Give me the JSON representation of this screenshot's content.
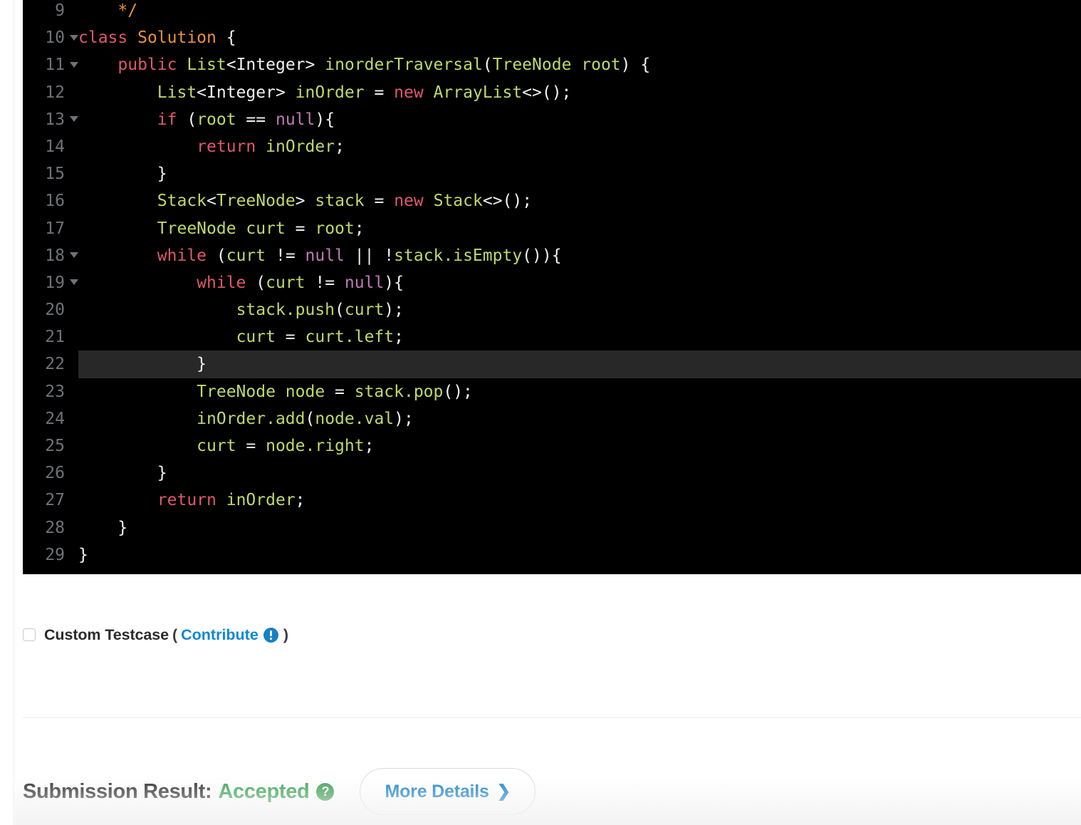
{
  "editor": {
    "language": "java",
    "theme_background": "#000000",
    "active_line": 22,
    "colors": {
      "keyword": "#e0586a",
      "identifier": "#bfd96a",
      "null_literal": "#c07ab5",
      "class_name": "#e9913f",
      "comment": "#e9913f",
      "punctuation": "#f2f2f2",
      "gutter": "#6f7276",
      "active_line_bg": "#282828"
    },
    "lines": [
      {
        "n": "9",
        "fold": false,
        "tokens": [
          {
            "t": "    ",
            "c": "plain"
          },
          {
            "t": "*/",
            "c": "cmt"
          }
        ]
      },
      {
        "n": "10",
        "fold": true,
        "tokens": [
          {
            "t": "class ",
            "c": "kw"
          },
          {
            "t": "Solution",
            "c": "class"
          },
          {
            "t": " {",
            "c": "plain"
          }
        ]
      },
      {
        "n": "11",
        "fold": true,
        "tokens": [
          {
            "t": "    ",
            "c": "plain"
          },
          {
            "t": "public",
            "c": "kw"
          },
          {
            "t": " ",
            "c": "plain"
          },
          {
            "t": "List",
            "c": "type"
          },
          {
            "t": "<Integer>",
            "c": "plain"
          },
          {
            "t": " ",
            "c": "plain"
          },
          {
            "t": "inorderTraversal",
            "c": "id"
          },
          {
            "t": "(",
            "c": "plain"
          },
          {
            "t": "TreeNode root",
            "c": "id"
          },
          {
            "t": ") {",
            "c": "plain"
          }
        ]
      },
      {
        "n": "12",
        "fold": false,
        "tokens": [
          {
            "t": "        ",
            "c": "plain"
          },
          {
            "t": "List",
            "c": "type"
          },
          {
            "t": "<Integer>",
            "c": "plain"
          },
          {
            "t": " ",
            "c": "plain"
          },
          {
            "t": "inOrder",
            "c": "id"
          },
          {
            "t": " = ",
            "c": "plain"
          },
          {
            "t": "new",
            "c": "kw"
          },
          {
            "t": " ",
            "c": "plain"
          },
          {
            "t": "ArrayList",
            "c": "type"
          },
          {
            "t": "<>();",
            "c": "plain"
          }
        ]
      },
      {
        "n": "13",
        "fold": true,
        "tokens": [
          {
            "t": "        ",
            "c": "plain"
          },
          {
            "t": "if",
            "c": "kw"
          },
          {
            "t": " (",
            "c": "plain"
          },
          {
            "t": "root",
            "c": "id"
          },
          {
            "t": " == ",
            "c": "plain"
          },
          {
            "t": "null",
            "c": "null"
          },
          {
            "t": "){",
            "c": "plain"
          }
        ]
      },
      {
        "n": "14",
        "fold": false,
        "tokens": [
          {
            "t": "            ",
            "c": "plain"
          },
          {
            "t": "return",
            "c": "kw"
          },
          {
            "t": " ",
            "c": "plain"
          },
          {
            "t": "inOrder",
            "c": "id"
          },
          {
            "t": ";",
            "c": "plain"
          }
        ]
      },
      {
        "n": "15",
        "fold": false,
        "tokens": [
          {
            "t": "        }",
            "c": "plain"
          }
        ]
      },
      {
        "n": "16",
        "fold": false,
        "tokens": [
          {
            "t": "        ",
            "c": "plain"
          },
          {
            "t": "Stack",
            "c": "type"
          },
          {
            "t": "<",
            "c": "plain"
          },
          {
            "t": "TreeNode",
            "c": "type"
          },
          {
            "t": ">",
            "c": "plain"
          },
          {
            "t": " ",
            "c": "plain"
          },
          {
            "t": "stack",
            "c": "id"
          },
          {
            "t": " = ",
            "c": "plain"
          },
          {
            "t": "new",
            "c": "kw"
          },
          {
            "t": " ",
            "c": "plain"
          },
          {
            "t": "Stack",
            "c": "type"
          },
          {
            "t": "<>();",
            "c": "plain"
          }
        ]
      },
      {
        "n": "17",
        "fold": false,
        "tokens": [
          {
            "t": "        ",
            "c": "plain"
          },
          {
            "t": "TreeNode curt",
            "c": "id"
          },
          {
            "t": " = ",
            "c": "plain"
          },
          {
            "t": "root",
            "c": "id"
          },
          {
            "t": ";",
            "c": "plain"
          }
        ]
      },
      {
        "n": "18",
        "fold": true,
        "tokens": [
          {
            "t": "        ",
            "c": "plain"
          },
          {
            "t": "while",
            "c": "kw"
          },
          {
            "t": " (",
            "c": "plain"
          },
          {
            "t": "curt",
            "c": "id"
          },
          {
            "t": " != ",
            "c": "plain"
          },
          {
            "t": "null",
            "c": "null"
          },
          {
            "t": " || !",
            "c": "plain"
          },
          {
            "t": "stack.isEmpty",
            "c": "id"
          },
          {
            "t": "()){",
            "c": "plain"
          }
        ]
      },
      {
        "n": "19",
        "fold": true,
        "tokens": [
          {
            "t": "            ",
            "c": "plain"
          },
          {
            "t": "while",
            "c": "kw"
          },
          {
            "t": " (",
            "c": "plain"
          },
          {
            "t": "curt",
            "c": "id"
          },
          {
            "t": " != ",
            "c": "plain"
          },
          {
            "t": "null",
            "c": "null"
          },
          {
            "t": "){",
            "c": "plain"
          }
        ]
      },
      {
        "n": "20",
        "fold": false,
        "tokens": [
          {
            "t": "                ",
            "c": "plain"
          },
          {
            "t": "stack.push",
            "c": "id"
          },
          {
            "t": "(",
            "c": "plain"
          },
          {
            "t": "curt",
            "c": "id"
          },
          {
            "t": ");",
            "c": "plain"
          }
        ]
      },
      {
        "n": "21",
        "fold": false,
        "tokens": [
          {
            "t": "                ",
            "c": "plain"
          },
          {
            "t": "curt",
            "c": "id"
          },
          {
            "t": " = ",
            "c": "plain"
          },
          {
            "t": "curt.left",
            "c": "id"
          },
          {
            "t": ";",
            "c": "plain"
          }
        ]
      },
      {
        "n": "22",
        "fold": false,
        "active": true,
        "tokens": [
          {
            "t": "            }",
            "c": "plain"
          }
        ]
      },
      {
        "n": "23",
        "fold": false,
        "tokens": [
          {
            "t": "            ",
            "c": "plain"
          },
          {
            "t": "TreeNode node",
            "c": "id"
          },
          {
            "t": " = ",
            "c": "plain"
          },
          {
            "t": "stack.pop",
            "c": "id"
          },
          {
            "t": "();",
            "c": "plain"
          }
        ]
      },
      {
        "n": "24",
        "fold": false,
        "tokens": [
          {
            "t": "            ",
            "c": "plain"
          },
          {
            "t": "inOrder.add",
            "c": "id"
          },
          {
            "t": "(",
            "c": "plain"
          },
          {
            "t": "node.val",
            "c": "id"
          },
          {
            "t": ");",
            "c": "plain"
          }
        ]
      },
      {
        "n": "25",
        "fold": false,
        "tokens": [
          {
            "t": "            ",
            "c": "plain"
          },
          {
            "t": "curt",
            "c": "id"
          },
          {
            "t": " = ",
            "c": "plain"
          },
          {
            "t": "node.right",
            "c": "id"
          },
          {
            "t": ";",
            "c": "plain"
          }
        ]
      },
      {
        "n": "26",
        "fold": false,
        "tokens": [
          {
            "t": "        }",
            "c": "plain"
          }
        ]
      },
      {
        "n": "27",
        "fold": false,
        "tokens": [
          {
            "t": "        ",
            "c": "plain"
          },
          {
            "t": "return",
            "c": "kw"
          },
          {
            "t": " ",
            "c": "plain"
          },
          {
            "t": "inOrder",
            "c": "id"
          },
          {
            "t": ";",
            "c": "plain"
          }
        ]
      },
      {
        "n": "28",
        "fold": false,
        "tokens": [
          {
            "t": "    }",
            "c": "plain"
          }
        ]
      },
      {
        "n": "29",
        "fold": false,
        "tokens": [
          {
            "t": "}",
            "c": "plain"
          }
        ]
      }
    ]
  },
  "testcase": {
    "checkbox_checked": false,
    "label": "Custom Testcase",
    "open_paren": "(",
    "contribute_label": "Contribute",
    "info_icon": "exclamation-circle-icon",
    "close_paren": ")"
  },
  "result": {
    "label": "Submission Result:",
    "status": "Accepted",
    "status_color": "#36a250",
    "help_icon": "question-mark-circle-icon",
    "help_glyph": "?",
    "more_details_label": "More Details",
    "chevron": "❯"
  }
}
